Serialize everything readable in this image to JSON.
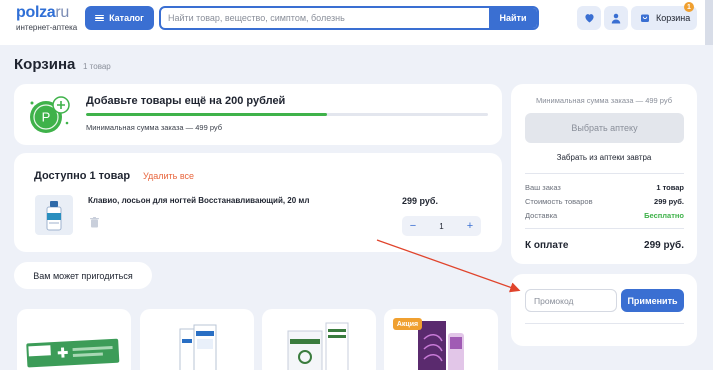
{
  "header": {
    "logo_main": "polza",
    "logo_suffix": "ru",
    "logo_sub": "интернет-аптека",
    "catalog_label": "Каталог",
    "search_placeholder": "Найти товар, вещество, симптом, болезнь",
    "search_button": "Найти",
    "cart_label": "Корзина",
    "cart_badge": "1",
    "icons": [
      "heart-icon",
      "user-icon",
      "cart-icon",
      "burger-icon"
    ]
  },
  "page": {
    "title": "Корзина",
    "count": "1 товар"
  },
  "promo": {
    "title": "Добавьте товары ещё на 200 рублей",
    "subtitle": "Минимальная сумма заказа — 499 руб",
    "progress_percent": 60,
    "progress_color": "#3fb24a"
  },
  "available": {
    "title": "Доступно 1 товар",
    "remove_all": "Удалить все",
    "product": {
      "name": "Клавио, лосьон для ногтей Восстанавливающий, 20 мл",
      "price": "299 руб.",
      "quantity": "1",
      "minus": "−",
      "plus": "+"
    }
  },
  "suggest": {
    "label": "Вам может пригодиться",
    "badge": "Акция"
  },
  "summary": {
    "min_sum": "Минимальная сумма заказа — 499 руб",
    "pick_pharmacy": "Выбрать аптеку",
    "pickup": "Забрать из аптеки завтра",
    "rows": [
      {
        "label": "Ваш заказ",
        "value": "1 товар"
      },
      {
        "label": "Стоимость товаров",
        "value": "299 руб."
      },
      {
        "label": "Доставка",
        "value": "Бесплатно"
      }
    ],
    "total_label": "К оплате",
    "total_value": "299 руб."
  },
  "promo_code": {
    "placeholder": "Промокод",
    "apply": "Применить"
  },
  "colors": {
    "accent": "#3a6fd2",
    "success": "#3fb24a",
    "danger_link": "#e8663e",
    "badge": "#f0a030",
    "annotation_arrow": "#e0442c"
  }
}
